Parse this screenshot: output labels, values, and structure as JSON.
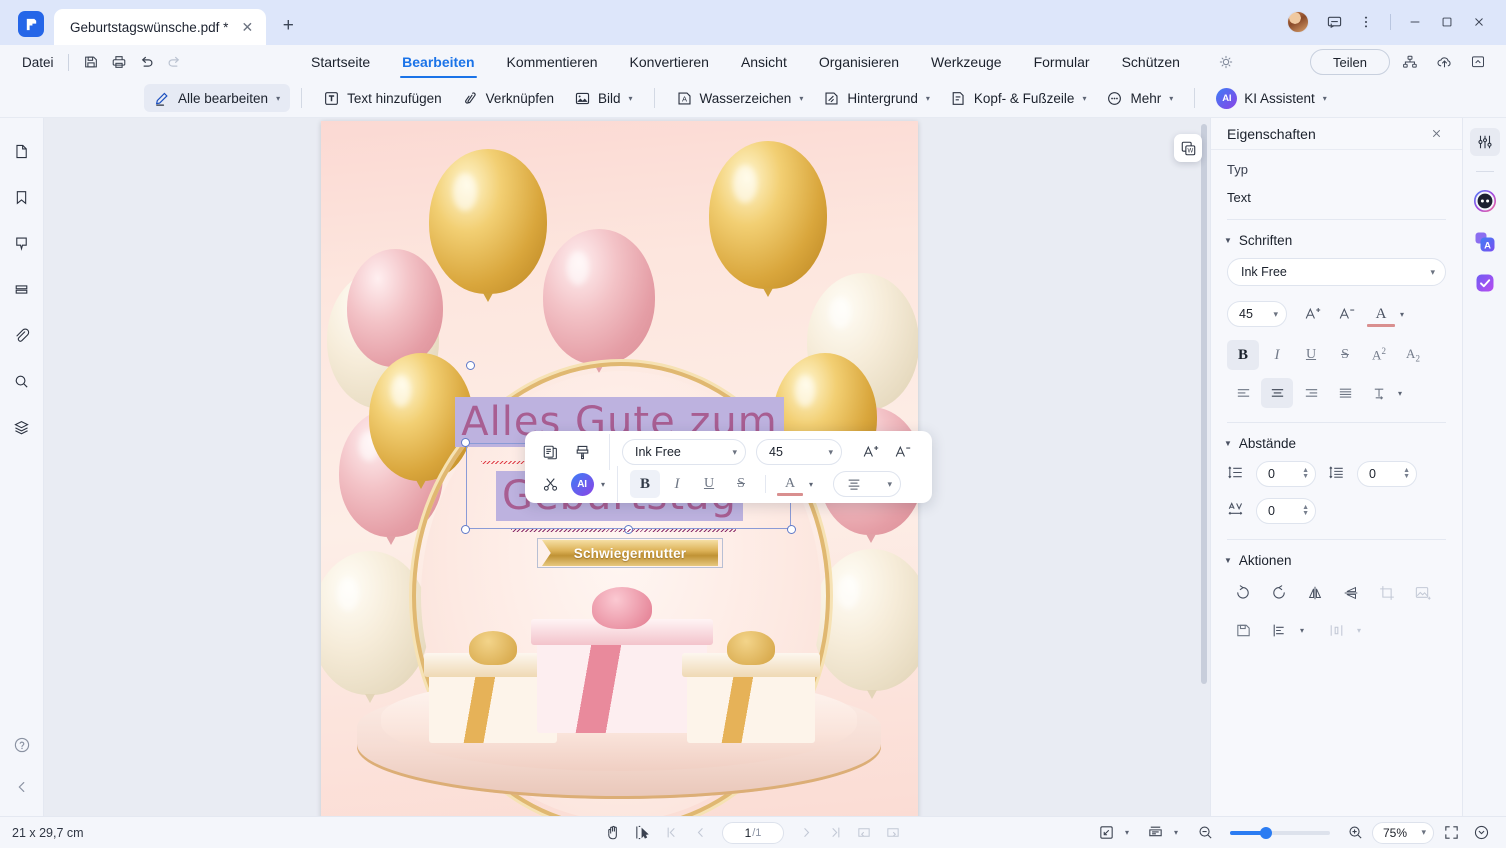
{
  "window": {
    "app_logo": "pdf-app-logo",
    "tab_title": "Geburtstagswünsche.pdf *",
    "tab_close": "✕",
    "new_tab": "+",
    "minimize": "—",
    "maximize": "▢",
    "close": "✕"
  },
  "menubar": {
    "file_label": "Datei",
    "items": [
      {
        "label": "Startseite",
        "active": false
      },
      {
        "label": "Bearbeiten",
        "active": true
      },
      {
        "label": "Kommentieren",
        "active": false
      },
      {
        "label": "Konvertieren",
        "active": false
      },
      {
        "label": "Ansicht",
        "active": false
      },
      {
        "label": "Organisieren",
        "active": false
      },
      {
        "label": "Werkzeuge",
        "active": false
      },
      {
        "label": "Formular",
        "active": false
      },
      {
        "label": "Schützen",
        "active": false
      }
    ],
    "share_label": "Teilen"
  },
  "ribbon": {
    "items": [
      {
        "label": "Alle bearbeiten",
        "caret": true,
        "selected": true
      },
      {
        "label": "Text hinzufügen",
        "caret": false,
        "selected": false
      },
      {
        "label": "Verknüpfen",
        "caret": false,
        "selected": false
      },
      {
        "label": "Bild",
        "caret": true,
        "selected": false
      },
      {
        "label": "Wasserzeichen",
        "caret": true,
        "selected": false
      },
      {
        "label": "Hintergrund",
        "caret": true,
        "selected": false
      },
      {
        "label": "Kopf- & Fußzeile",
        "caret": true,
        "selected": false
      },
      {
        "label": "Mehr",
        "caret": true,
        "selected": false
      }
    ],
    "ai_badge": "AI",
    "ai_label": "KI Assistent"
  },
  "format_toolbar": {
    "font_name": "Ink Free",
    "font_size": "45",
    "grow_label": "A+",
    "shrink_label": "A-",
    "bold": "B",
    "italic": "I",
    "underline": "U",
    "strike": "S"
  },
  "document": {
    "line1": "Alles Gute zum",
    "line2": "Geburtstag",
    "banner": "Schwiegermutter"
  },
  "properties": {
    "title": "Eigenschaften",
    "type_label": "Typ",
    "type_value": "Text",
    "fonts_section": "Schriften",
    "font_name": "Ink Free",
    "font_size": "45",
    "spacing_section": "Abstände",
    "line_spacing": "0",
    "paragraph_spacing": "0",
    "char_spacing": "0",
    "actions_section": "Aktionen"
  },
  "status": {
    "page_size": "21 x 29,7 cm",
    "current_page": "1",
    "total_pages": "/1",
    "zoom": "75%"
  },
  "colors": {
    "accent": "#1a73e8",
    "text_highlight": "#bdb2df",
    "card_text": "#a85e92",
    "gold": "#d9a63c"
  }
}
